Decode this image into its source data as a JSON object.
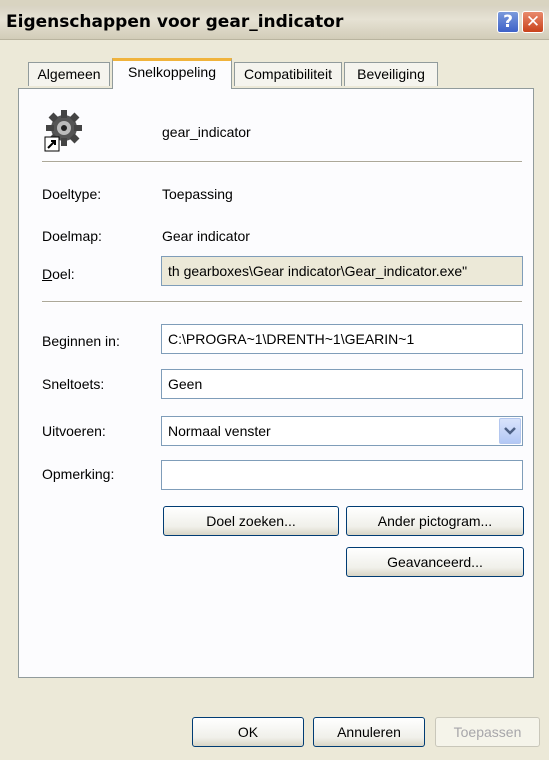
{
  "window": {
    "title": "Eigenschappen voor gear_indicator",
    "help_glyph": "?",
    "close_glyph": "✕"
  },
  "tabs": [
    {
      "label": "Algemeen"
    },
    {
      "label": "Snelkoppeling",
      "active": true
    },
    {
      "label": "Compatibiliteit"
    },
    {
      "label": "Beveiliging"
    }
  ],
  "shortcut": {
    "icon": "gear-shortcut-icon",
    "name": "gear_indicator"
  },
  "info": {
    "doeltype_label": "Doeltype:",
    "doeltype_value": "Toepassing",
    "doelmap_label": "Doelmap:",
    "doelmap_value": "Gear indicator",
    "doel_label": "Doel:",
    "doel_value": "th gearboxes\\Gear indicator\\Gear_indicator.exe\""
  },
  "fields": {
    "beginnen_label": "Beginnen in:",
    "beginnen_value": "C:\\PROGRA~1\\DRENTH~1\\GEARIN~1",
    "sneltoets_label": "Sneltoets:",
    "sneltoets_value": "Geen",
    "uitvoeren_label": "Uitvoeren:",
    "uitvoeren_value": "Normaal venster",
    "opmerking_label": "Opmerking:",
    "opmerking_value": ""
  },
  "buttons": {
    "doel_zoeken": "Doel zoeken...",
    "ander_pictogram": "Ander pictogram...",
    "geavanceerd": "Geavanceerd...",
    "ok": "OK",
    "annuleren": "Annuleren",
    "toepassen": "Toepassen"
  },
  "colors": {
    "dialog_bg": "#ece9d8",
    "panel_bg": "#fcfcfe",
    "active_tab_accent": "#f0b33c",
    "close_red": "#c9421b",
    "help_blue": "#3e61c8"
  }
}
